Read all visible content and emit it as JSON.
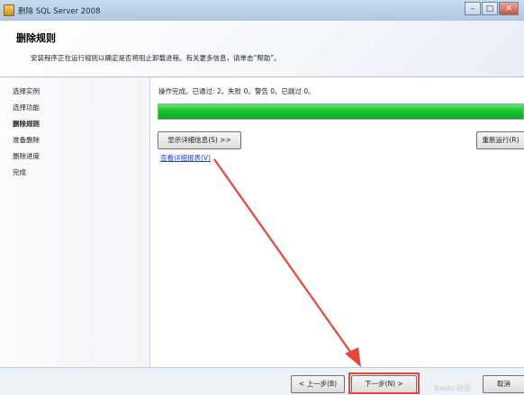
{
  "window": {
    "title": "删除 SQL Server 2008",
    "controls": {
      "minimize": "–",
      "maximize": "□",
      "close": "✕"
    }
  },
  "header": {
    "title": "删除规则",
    "description": "安装程序正在运行规则以确定是否将阻止卸载进程。有关更多信息，请单击“帮助”。"
  },
  "sidebar": {
    "steps": [
      {
        "label": "选择实例",
        "active": false
      },
      {
        "label": "选择功能",
        "active": false
      },
      {
        "label": "删除规则",
        "active": true
      },
      {
        "label": "准备删除",
        "active": false
      },
      {
        "label": "删除进度",
        "active": false
      },
      {
        "label": "完成",
        "active": false
      }
    ]
  },
  "main": {
    "status": "操作完成。已通过: 2。失败 0。警告 0。已跳过 0。",
    "progress_fraction": 1.0,
    "progress_color": "#18c42e",
    "show_details_button": "显示详细信息(S) >>",
    "rerun_button": "重新运行(R)",
    "report_link": "查看详细报表(V)"
  },
  "annotations": {
    "arrow_color": "#e6453a"
  },
  "footer": {
    "back_button": "< 上一步(B)",
    "next_button": "下一步(N) >",
    "cancel_button": "取消"
  },
  "watermark": "Baidu 经验"
}
